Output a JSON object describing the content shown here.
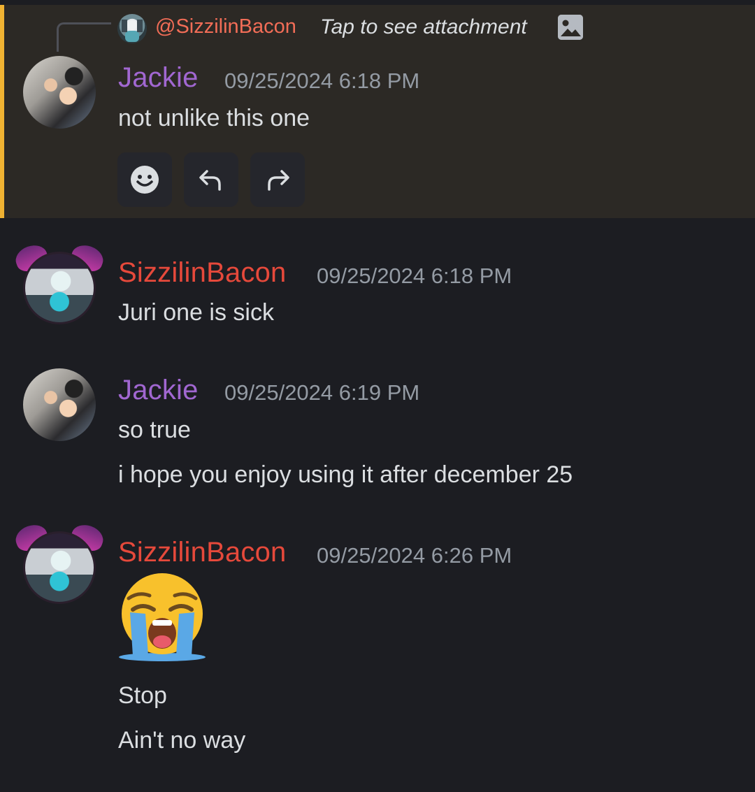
{
  "reply": {
    "mention": "@SizzilinBacon",
    "text": "Tap to see attachment",
    "image_icon": "image-icon"
  },
  "messages": [
    {
      "author": "Jackie",
      "timestamp": "09/25/2024 6:18 PM",
      "lines": [
        "not unlike this one"
      ]
    },
    {
      "author": "SizzilinBacon",
      "timestamp": "09/25/2024 6:18 PM",
      "lines": [
        "Juri one is sick"
      ]
    },
    {
      "author": "Jackie",
      "timestamp": "09/25/2024 6:19 PM",
      "lines": [
        "so true",
        "i hope you enjoy using it after december 25"
      ]
    },
    {
      "author": "SizzilinBacon",
      "timestamp": "09/25/2024 6:26 PM",
      "emoji": "loudly-crying-face",
      "lines": [
        "Stop",
        "Ain't no way"
      ]
    }
  ],
  "actions": [
    {
      "icon": "emoji-reaction-icon"
    },
    {
      "icon": "reply-icon"
    },
    {
      "icon": "forward-icon"
    }
  ],
  "colors": {
    "background": "#1c1d22",
    "highlight_background": "#2c2925",
    "highlight_bar": "#f0b232",
    "jackie_name": "#a167d1",
    "bacon_name": "#e6493b",
    "mention": "#f26d57",
    "timestamp": "#949ba4",
    "text": "#dbdee1"
  }
}
